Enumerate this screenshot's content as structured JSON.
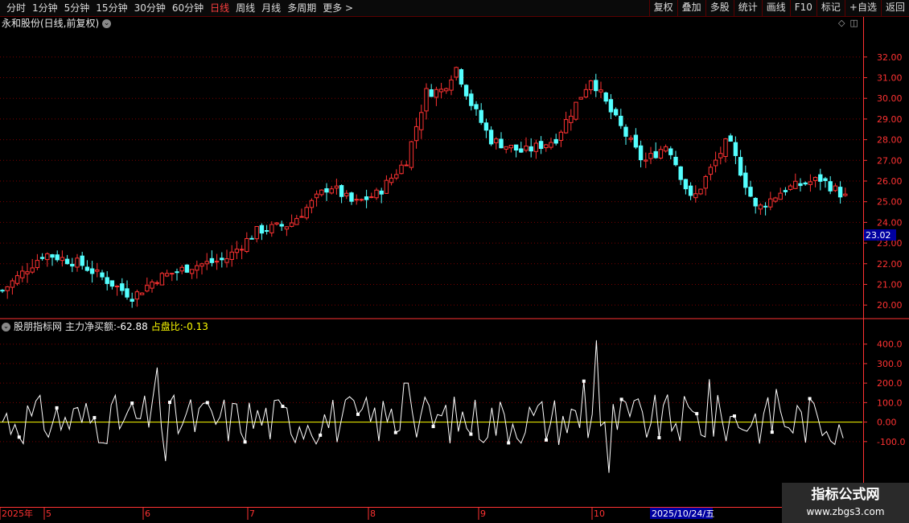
{
  "toolbar": {
    "periods": [
      "分时",
      "1分钟",
      "5分钟",
      "15分钟",
      "30分钟",
      "60分钟",
      "日线",
      "周线",
      "月线",
      "多周期",
      "更多 >"
    ],
    "active_period": "日线",
    "right_buttons": [
      "复权",
      "叠加",
      "多股",
      "统计",
      "画线",
      "F10",
      "标记",
      "+自选",
      "返回"
    ]
  },
  "main_chart": {
    "title": "永和股份(日线,前复权)",
    "price_axis": [
      "32.00",
      "31.00",
      "30.00",
      "29.00",
      "28.00",
      "27.00",
      "26.00",
      "25.00",
      "24.00",
      "23.00",
      "22.00",
      "21.00",
      "20.00"
    ],
    "price_range": [
      19.5,
      33.2
    ],
    "current_price_label": "23.02",
    "colors": {
      "up": "#ff3232",
      "down": "#54ffff",
      "grid": "#8b0000",
      "axis": "#ff3232"
    }
  },
  "sub_chart": {
    "indicator_name": "股朋指标网",
    "net_buy_label": "主力净买额:",
    "net_buy_value": "-62.88",
    "ratio_label": "占盘比:",
    "ratio_value": "-0.13",
    "axis": [
      "400.0",
      "300.0",
      "200.0",
      "100.0",
      "0.00",
      "-100.0"
    ],
    "value_range": [
      -270,
      440
    ],
    "colors": {
      "line": "#ffffff",
      "zero_line": "#ffff00"
    }
  },
  "time_axis": {
    "labels": [
      "2025年",
      "5",
      "6",
      "7",
      "8",
      "9",
      "10"
    ],
    "cursor_date": "2025/10/24/五"
  },
  "watermark": {
    "line1": "指标公式网",
    "line2": "www.zbgs3.com"
  }
}
